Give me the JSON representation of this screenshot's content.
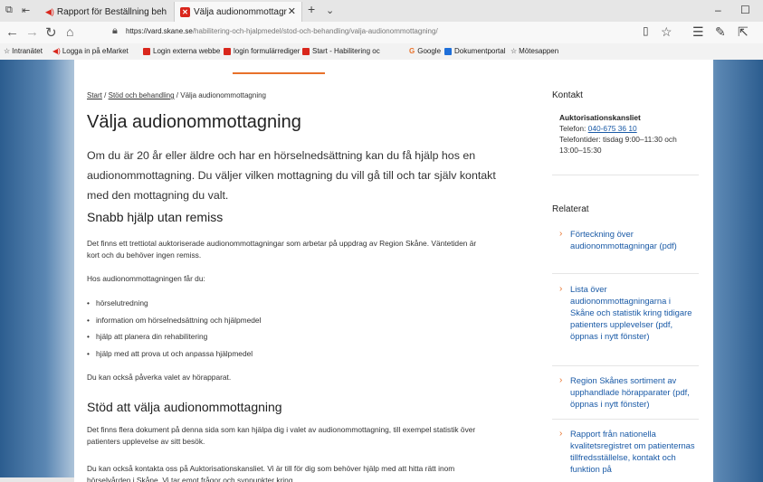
{
  "browser": {
    "tabs": [
      {
        "label": "Rapport för Beställning beh"
      },
      {
        "label": "Välja audionommottagr"
      }
    ],
    "url_host": "https://vard.skane.se",
    "url_path": "/habilitering-och-hjalpmedel/stod-och-behandling/valja-audionommottagning/",
    "favorites": [
      {
        "label": "Intranätet"
      },
      {
        "label": "Logga in på eMarket"
      },
      {
        "label": "Login externa webbe"
      },
      {
        "label": "login formulärrediger"
      },
      {
        "label": "Start - Habilitering oc"
      },
      {
        "label": "Google"
      },
      {
        "label": "Dokumentportal"
      },
      {
        "label": "Mötesappen"
      }
    ]
  },
  "breadcrumb": {
    "start": "Start",
    "sep1": "/",
    "level2": "Stöd och behandling",
    "sep2": "/",
    "current": "Välja audionommottagning"
  },
  "main": {
    "title": "Välja audionommottagning",
    "lead": "Om du är 20 år eller äldre och har en hörselnedsättning kan du få hjälp hos en audionommottagning. Du väljer vilken mottagning du vill gå till och tar själv kontakt med den mottagning du valt.",
    "section1_heading": "Snabb hjälp utan remiss",
    "section1_p1": "Det finns ett trettiotal auktoriserade audionommottagningar som arbetar på uppdrag av Region Skåne. Väntetiden är kort och du behöver ingen remiss.",
    "section1_p2": "Hos audionommottagningen får du:",
    "bullets": [
      "hörselutredning",
      "information om hörselnedsättning och hjälpmedel",
      "hjälp att planera din rehabilitering",
      "hjälp med att prova ut och anpassa hjälpmedel"
    ],
    "section1_p3": "Du kan också påverka valet av hörapparat.",
    "section2_heading": "Stöd att välja audionommottagning",
    "section2_p1": "Det finns flera dokument på denna sida som kan hjälpa dig i valet av audionommottagning, till exempel statistik över patienters upplevelse av sitt besök.",
    "section2_p2": "Du kan också kontakta oss på Auktorisationskansliet. Vi är till för dig som behöver hjälp med att hitta rätt inom hörselvården i Skåne. Vi tar emot frågor och synpunkter kring"
  },
  "sidebar": {
    "contact_heading": "Kontakt",
    "contact_name": "Auktorisationskansliet",
    "phone_label": "Telefon:",
    "phone": "040-675 36 10",
    "hours": "Telefontider: tisdag 9:00–11:30 och 13:00–15:30",
    "related_heading": "Relaterat",
    "related": [
      {
        "label": "Förteckning över audionommottagningar (pdf)"
      },
      {
        "label": "Lista över audionommottagningarna i Skåne och statistik kring tidigare patienters upplevelser (pdf, öppnas i nytt fönster)"
      },
      {
        "label": "Region Skånes sortiment av upphandlade hörapparater (pdf, öppnas i nytt fönster)"
      },
      {
        "label": "Rapport från nationella kvalitetsregistret om patienternas tillfredsställelse, kontakt och funktion på"
      }
    ]
  },
  "colors": {
    "accent": "#e8712a",
    "link": "#1a5aa6",
    "brand_red": "#d9261c"
  }
}
